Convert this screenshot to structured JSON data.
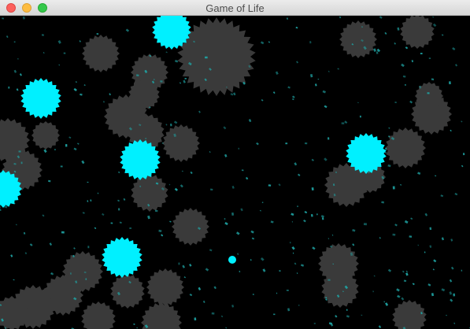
{
  "window": {
    "title": "Game of Life",
    "buttons": {
      "close": "close",
      "minimize": "minimize",
      "maximize": "maximize"
    }
  },
  "scene": {
    "background_color": "#000000",
    "blob_color": "#3a3a3a",
    "bright_cell_color": "#00f0ff",
    "particle_color": "#1fa5a5"
  }
}
